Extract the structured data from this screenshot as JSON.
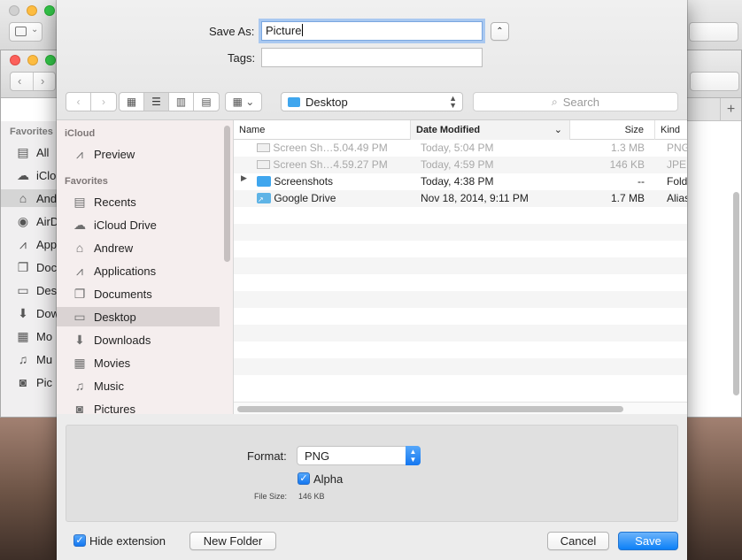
{
  "background": {
    "sidebar": {
      "header": "Favorites",
      "items": [
        "All",
        "iClo",
        "And",
        "AirD",
        "App",
        "Doc",
        "Des",
        "Dow",
        "Mo",
        "Mu",
        "Pic"
      ]
    }
  },
  "dialog": {
    "save_as_label": "Save As:",
    "save_as_value": "Picture",
    "tags_label": "Tags:",
    "tags_value": "",
    "location": "Desktop",
    "search_placeholder": "Search",
    "sidebar": {
      "sections": [
        {
          "header": "iCloud",
          "items": [
            {
              "label": "Preview",
              "icon": "applications-icon"
            }
          ]
        },
        {
          "header": "Favorites",
          "items": [
            {
              "label": "Recents",
              "icon": "recents-icon"
            },
            {
              "label": "iCloud Drive",
              "icon": "cloud-icon"
            },
            {
              "label": "Andrew",
              "icon": "home-icon"
            },
            {
              "label": "Applications",
              "icon": "applications-icon"
            },
            {
              "label": "Documents",
              "icon": "documents-icon"
            },
            {
              "label": "Desktop",
              "icon": "desktop-icon",
              "selected": true
            },
            {
              "label": "Downloads",
              "icon": "downloads-icon"
            },
            {
              "label": "Movies",
              "icon": "movies-icon"
            },
            {
              "label": "Music",
              "icon": "music-icon"
            },
            {
              "label": "Pictures",
              "icon": "pictures-icon"
            }
          ]
        }
      ]
    },
    "columns": {
      "name": "Name",
      "date": "Date Modified",
      "size": "Size",
      "kind": "Kind"
    },
    "files": [
      {
        "name": "Screen Sh…5.04.49 PM",
        "date": "Today, 5:04 PM",
        "size": "1.3 MB",
        "kind": "PNG",
        "dim": true,
        "icon": "image-file-icon"
      },
      {
        "name": "Screen Sh…4.59.27 PM",
        "date": "Today, 4:59 PM",
        "size": "146 KB",
        "kind": "JPE",
        "dim": true,
        "icon": "image-file-icon"
      },
      {
        "name": "Screenshots",
        "date": "Today, 4:38 PM",
        "size": "--",
        "kind": "Fold",
        "dim": false,
        "icon": "folder-icon",
        "expandable": true
      },
      {
        "name": "Google Drive",
        "date": "Nov 18, 2014, 9:11 PM",
        "size": "1.7 MB",
        "kind": "Alias",
        "dim": false,
        "icon": "alias-folder-icon"
      }
    ],
    "options": {
      "format_label": "Format:",
      "format_value": "PNG",
      "alpha_label": "Alpha",
      "alpha_checked": true,
      "file_size_label": "File Size:",
      "file_size_value": "146 KB"
    },
    "footer": {
      "hide_extension_label": "Hide extension",
      "hide_extension_checked": true,
      "new_folder": "New Folder",
      "cancel": "Cancel",
      "save": "Save"
    }
  },
  "colors": {
    "accent": "#1477f0",
    "selection": "#dad3d3",
    "folder": "#3fa6ee"
  }
}
